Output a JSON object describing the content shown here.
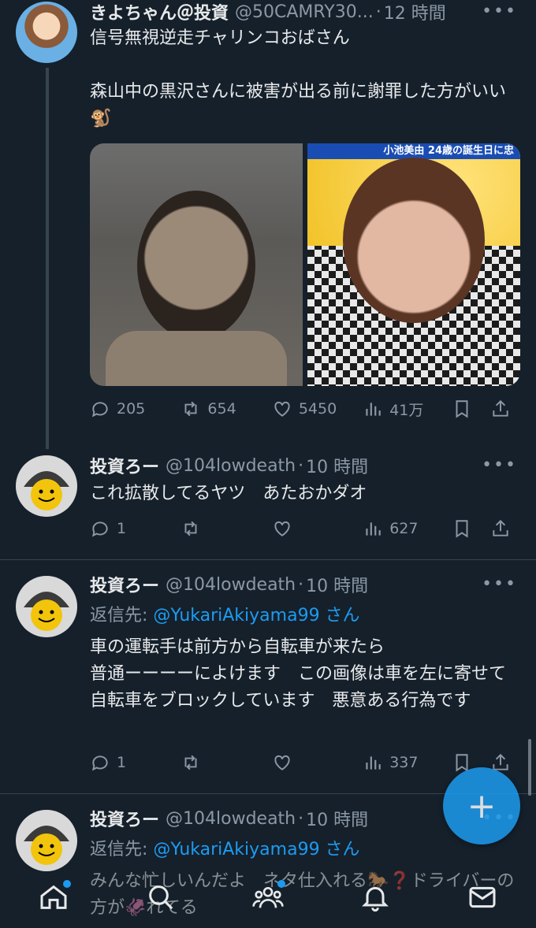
{
  "tweets": [
    {
      "name": "きよちゃん＠投資",
      "handle": "@50CAMRY30...",
      "time": "12 時間",
      "text": "信号無視逆走チャリンコおばさん\n\n森山中の黒沢さんに被害が出る前に謝罪した方がいい🐒",
      "media_caption": "小池美由 24歳の誕生日に忠",
      "replies": "205",
      "retweets": "654",
      "likes": "5450",
      "views": "41万"
    },
    {
      "name": "投資ろー",
      "handle": "@104lowdeath",
      "time": "10 時間",
      "text": "これ拡散してるヤツ　あたおかダオ",
      "replies": "1",
      "retweets": "",
      "likes": "",
      "views": "627"
    },
    {
      "name": "投資ろー",
      "handle": "@104lowdeath",
      "time": "10 時間",
      "reply_prefix": "返信先: ",
      "reply_mention": "@YukariAkiyama99 さん",
      "text": "車の運転手は前方から自転車が来たら\n普通ーーーーによけます　この画像は車を左に寄せて自転車をブロックしています　悪意ある行為です",
      "replies": "1",
      "retweets": "",
      "likes": "",
      "views": "337"
    },
    {
      "name": "投資ろー",
      "handle": "@104lowdeath",
      "time": "10 時間",
      "reply_prefix": "返信先: ",
      "reply_mention": "@YukariAkiyama99 さん",
      "text": "みんな忙しいんだよ　ネタ仕入れる🐎❓ドライバーの方が🦑れてる"
    }
  ],
  "more_label": "•••",
  "fab_label": "+",
  "nav": [
    "home-icon",
    "search-icon",
    "communities-icon",
    "notifications-icon",
    "messages-icon"
  ]
}
